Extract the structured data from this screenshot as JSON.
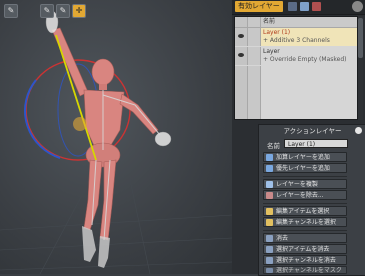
{
  "viewport": {
    "top_buttons": [
      "✎",
      "✎",
      "✎",
      "✛"
    ]
  },
  "layers_panel": {
    "tab_label": "有効レイヤー",
    "column_header": "名前",
    "layers": [
      {
        "name": "Layer (1)",
        "detail": "+ Additive  3 Channels",
        "selected": true
      },
      {
        "name": "Layer",
        "detail": "+ Override  Empty  (Masked)",
        "selected": false
      }
    ]
  },
  "action_panel": {
    "title": "アクションレイヤー",
    "name_label": "名前",
    "name_value": "Layer (1)",
    "buttons": [
      "加算レイヤーを追加",
      "優先レイヤーを追加",
      "レイヤーを複製",
      "レイヤーを除去...",
      "編集アイテムを選択",
      "編集チャンネルを選択",
      "消去",
      "選択アイテムを消去",
      "選択チャンネルを消去",
      "選択チャンネルをマスク"
    ]
  },
  "colors": {
    "accent": "#e2a833",
    "ring_red": "#cc3333",
    "ring_blue": "#2d55c9",
    "figure": "#d98580",
    "bone": "#d7d700"
  }
}
